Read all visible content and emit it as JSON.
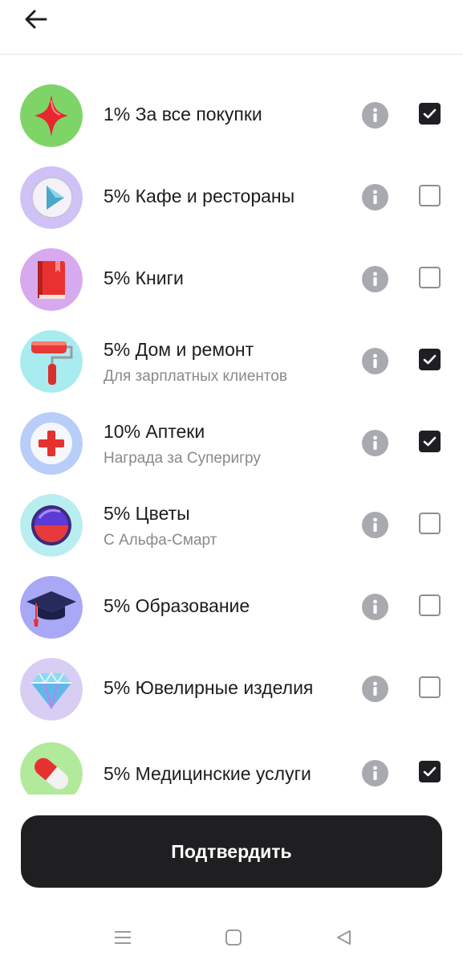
{
  "header": {
    "back_icon": "arrow-left-icon"
  },
  "categories": [
    {
      "title": "1% За все покупки",
      "subtitle": "",
      "checked": true,
      "icon": "star-icon",
      "bg": "#7ed467"
    },
    {
      "title": "5% Кафе и рестораны",
      "subtitle": "",
      "checked": false,
      "icon": "cafe-play-icon",
      "bg": "#cfc2f6"
    },
    {
      "title": "5% Книги",
      "subtitle": "",
      "checked": false,
      "icon": "book-icon",
      "bg": "#d7a9ee"
    },
    {
      "title": "5% Дом и ремонт",
      "subtitle": "Для зарплатных клиентов",
      "checked": true,
      "icon": "paint-roller-icon",
      "bg": "#a9ecf0"
    },
    {
      "title": "10% Аптеки",
      "subtitle": "Награда за Суперигру",
      "checked": true,
      "icon": "medical-cross-icon",
      "bg": "#b8cdf7"
    },
    {
      "title": "5% Цветы",
      "subtitle": "С Альфа-Смарт",
      "checked": false,
      "icon": "flowers-icon",
      "bg": "#b9eef0"
    },
    {
      "title": "5% Образование",
      "subtitle": "",
      "checked": false,
      "icon": "graduation-cap-icon",
      "bg": "#a9a8f6"
    },
    {
      "title": "5% Ювелирные изделия",
      "subtitle": "",
      "checked": false,
      "icon": "diamond-icon",
      "bg": "#d8cdf3"
    },
    {
      "title": "5% Медицинские услуги",
      "subtitle": "",
      "checked": true,
      "icon": "pill-capsule-icon",
      "bg": "#b2ea9c"
    }
  ],
  "confirm_button": {
    "label": "Подтвердить"
  },
  "navbar": {
    "menu_icon": "menu-icon",
    "home_icon": "home-square-icon",
    "back_icon": "back-triangle-icon"
  }
}
